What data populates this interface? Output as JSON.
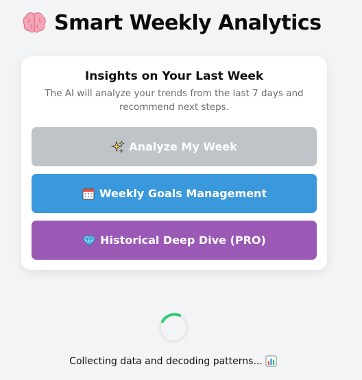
{
  "header": {
    "icon": "brain-icon",
    "title": "Smart Weekly Analytics"
  },
  "card": {
    "title": "Insights on Your Last Week",
    "subtitle": "The AI will analyze your trends from the last 7 days and recommend next steps.",
    "buttons": [
      {
        "icon": "sparkles-icon",
        "label": "Analyze My Week",
        "color": "#bfc4c8",
        "state": "disabled"
      },
      {
        "icon": "calendar-icon",
        "label": "Weekly Goals Management",
        "color": "#3a98dc"
      },
      {
        "icon": "gem-icon",
        "label": "Historical Deep Dive (PRO)",
        "color": "#9b59b6"
      }
    ]
  },
  "loading": {
    "spinner_color": "#2ecc71",
    "status_text": "Collecting data and decoding patterns...",
    "status_icon": "bar-chart-icon"
  }
}
